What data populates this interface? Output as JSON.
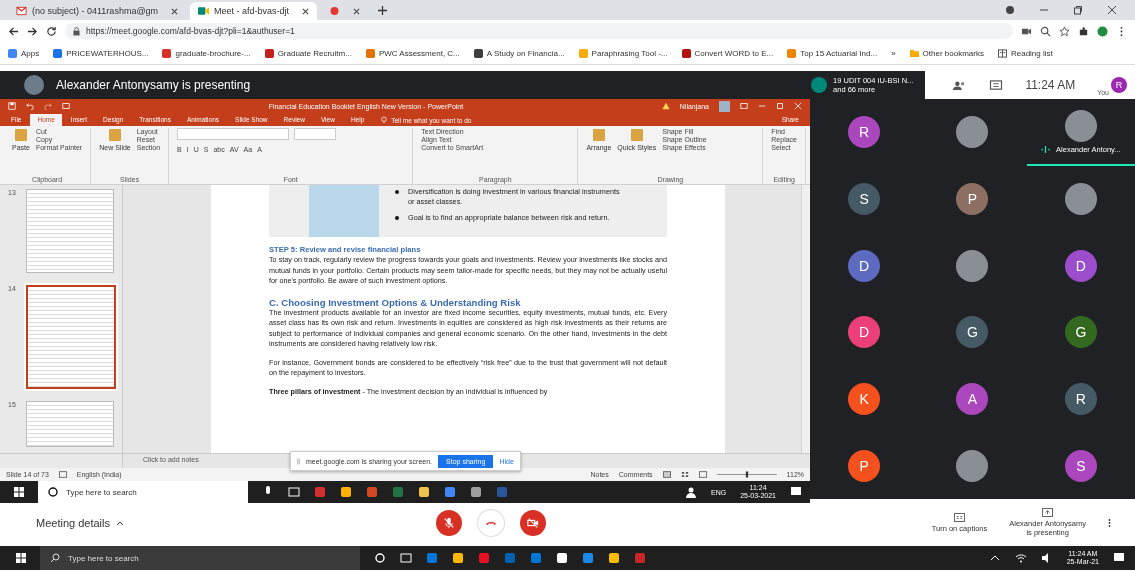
{
  "browser": {
    "tabs": [
      {
        "kind": "mail",
        "title": "(no subject) - 0411rashma@gm",
        "selected": false
      },
      {
        "kind": "meet",
        "title": "Meet - afd-bvas-djt",
        "selected": true
      },
      {
        "kind": "recording",
        "selected": false
      }
    ],
    "address": "https://meet.google.com/afd-bvas-djt?pli=1&authuser=1",
    "bookmarks": [
      {
        "label": "Apps",
        "color": "#4285f4"
      },
      {
        "label": "PRICEWATERHOUS...",
        "color": "#1a73e8"
      },
      {
        "label": "graduate-brochure-...",
        "color": "#d93025"
      },
      {
        "label": "Graduate Recruitm...",
        "color": "#c5221f"
      },
      {
        "label": "PWC Assessment, C...",
        "color": "#e37400"
      },
      {
        "label": "A Study on Financia...",
        "color": "#3c4043"
      },
      {
        "label": "Paraphrasing Tool -...",
        "color": "#f9ab00"
      },
      {
        "label": "Convert WORD to E...",
        "color": "#b31412"
      },
      {
        "label": "Top 15 Actuarial Ind...",
        "color": "#ea8600"
      }
    ],
    "more": "»",
    "other_bookmarks": "Other bookmarks",
    "reading_list": "Reading list"
  },
  "meet_header": {
    "presenting": "Alexander Antonysamy is presenting",
    "tile_line1": "19 UDIT 004 IU-BSI N...",
    "tile_line2": "and 66 more",
    "time": "11:24 AM",
    "you": "You",
    "you_initial": "R"
  },
  "powerpoint": {
    "title": "Financial Education Booklet English New Version - PowerPoint",
    "user": "Nilanjana",
    "tabs": [
      {
        "label": "File",
        "selected": false
      },
      {
        "label": "Home",
        "selected": true
      },
      {
        "label": "Insert",
        "selected": false
      },
      {
        "label": "Design",
        "selected": false
      },
      {
        "label": "Transitions",
        "selected": false
      },
      {
        "label": "Animations",
        "selected": false
      },
      {
        "label": "Slide Show",
        "selected": false
      },
      {
        "label": "Review",
        "selected": false
      },
      {
        "label": "View",
        "selected": false
      },
      {
        "label": "Help",
        "selected": false
      }
    ],
    "tell_me": "Tell me what you want to do",
    "share": "Share",
    "ribbon": [
      {
        "label": "Clipboard",
        "big": [
          "Paste"
        ],
        "items": [
          "Cut",
          "Copy",
          "Format Painter"
        ]
      },
      {
        "label": "Slides",
        "big": [
          "New Slide"
        ],
        "items": [
          "Layout",
          "Reset",
          "Section"
        ]
      },
      {
        "label": "Font",
        "glyphs": [
          "B",
          "I",
          "U",
          "S",
          "abc",
          "AV",
          "Aa",
          "A"
        ]
      },
      {
        "label": "Paragraph",
        "items": [
          "Text Direction",
          "Align Text",
          "Convert to SmartArt"
        ]
      },
      {
        "label": "Drawing",
        "big": [
          "Arrange",
          "Quick Styles"
        ],
        "items": [
          "Shape Fill",
          "Shape Outline",
          "Shape Effects"
        ]
      },
      {
        "label": "Editing",
        "items": [
          "Find",
          "Replace",
          "Select"
        ]
      }
    ],
    "thumbnails": [
      {
        "number": "13",
        "selected": false
      },
      {
        "number": "14",
        "selected": true
      },
      {
        "number": "15",
        "selected": false
      }
    ],
    "slide": {
      "bullets": [
        "Diversification is doing investment in various financial instruments or asset classes.",
        "Goal is to find an appropriate balance between risk and return."
      ],
      "blocks": [
        {
          "kind": "heading",
          "text": "STEP 5: Review and revise financial plans"
        },
        {
          "kind": "para",
          "text": "To stay on track, regularly review the progress towards your goals and investments. Review your investments like stocks and mutual funds in your portfolio. Certain products may seem tailor-made for specific needs, but they may not be actually useful for one's portfolio. Be aware of such investment options."
        },
        {
          "kind": "title",
          "text": "C. Choosing Investment Options & Understanding Risk"
        },
        {
          "kind": "para",
          "text": "The investment products available for an investor are fixed income securities, equity investments, mutual funds, etc. Every asset class has its own risk and return. Investments in equities are considered as high risk investments as their returns are subject to performance of individual companies and general economic scenario. On the other hand, investments in the debt instruments are considered having relatively low risk."
        },
        {
          "kind": "para",
          "text": "For instance, Government bonds are considered to be effectively “risk free” due to the trust that government will not default on the repayment to investors."
        },
        {
          "kind": "para",
          "text": "**Three pillars of investment** - The investment decision by an individual is influenced by"
        }
      ]
    },
    "notes": "Click to add notes",
    "status": {
      "slide": "Slide 14 of 73",
      "language": "English (India)",
      "notes": "Notes",
      "comments": "Comments",
      "zoom": "112%",
      "zoom_slider": {
        "level": 0.5
      }
    }
  },
  "share_bar": {
    "message": "meet.google.com is sharing your screen.",
    "stop": "Stop sharing",
    "hide": "Hide"
  },
  "inner_taskbar": {
    "search": "Type here to search",
    "apps": [
      {
        "color": "#d32f2f"
      },
      {
        "color": "#ffb300"
      },
      {
        "color": "#d24726"
      },
      {
        "color": "#217346"
      },
      {
        "color": "#f2c14e"
      },
      {
        "color": "#4285f4"
      },
      {
        "color": "#9e9e9e"
      },
      {
        "color": "#2b579a"
      }
    ],
    "language": "ENG",
    "time": "11:24",
    "date": "25-03-2021"
  },
  "tiles": [
    {
      "kind": "letter",
      "letter": "R",
      "color": "#ab47bc",
      "speaking": false
    },
    {
      "kind": "photo",
      "speaking": false
    },
    {
      "kind": "photo",
      "name": "Alexander Antony...",
      "speaking": true
    },
    {
      "kind": "letter",
      "letter": "S",
      "color": "#455a64",
      "speaking": false
    },
    {
      "kind": "letter",
      "letter": "P",
      "color": "#8d6e63",
      "speaking": false
    },
    {
      "kind": "photo",
      "speaking": false
    },
    {
      "kind": "letter",
      "letter": "D",
      "color": "#5c6bc0",
      "speaking": false
    },
    {
      "kind": "photo",
      "speaking": false
    },
    {
      "kind": "letter",
      "letter": "D",
      "color": "#9c4dcc",
      "speaking": false
    },
    {
      "kind": "letter",
      "letter": "D",
      "color": "#ec407a",
      "speaking": false
    },
    {
      "kind": "letter",
      "letter": "G",
      "color": "#455a64",
      "speaking": false
    },
    {
      "kind": "letter",
      "letter": "G",
      "color": "#33691e",
      "speaking": false
    },
    {
      "kind": "letter",
      "letter": "K",
      "color": "#f4511e",
      "speaking": false
    },
    {
      "kind": "letter",
      "letter": "A",
      "color": "#ab47bc",
      "speaking": false
    },
    {
      "kind": "letter",
      "letter": "R",
      "color": "#455a64",
      "speaking": false
    },
    {
      "kind": "letter",
      "letter": "P",
      "color": "#f4511e",
      "speaking": false
    },
    {
      "kind": "photo",
      "speaking": false
    },
    {
      "kind": "letter",
      "letter": "S",
      "color": "#ab47bc",
      "speaking": false
    }
  ],
  "meet_bar": {
    "details": "Meeting details",
    "controls": [
      {
        "kind": "mic",
        "off": true
      },
      {
        "kind": "hangup"
      },
      {
        "kind": "camera",
        "off": true
      }
    ],
    "captions": "Turn on captions",
    "presenter_name": "Alexander Antonysamy",
    "presenter_state": "is presenting"
  },
  "taskbar": {
    "search": "Type here to search",
    "apps": [
      {
        "color": "#0078d7"
      },
      {
        "color": "#ffb900"
      },
      {
        "color": "#e81123"
      },
      {
        "color": "#0063b1"
      },
      {
        "color": "#0078d7"
      },
      {
        "color": "#ffffff"
      },
      {
        "color": "#1e88e5"
      },
      {
        "color": "#fbbc05"
      },
      {
        "color": "#c62828"
      }
    ],
    "time": "11:24 AM",
    "date": "25-Mar-21"
  }
}
